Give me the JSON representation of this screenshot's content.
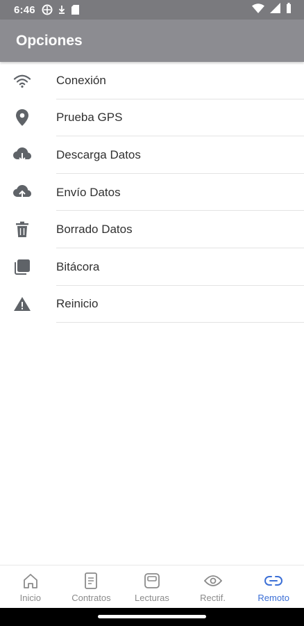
{
  "status_bar": {
    "time": "6:46",
    "icons": [
      "app-icon",
      "download-arrow-icon",
      "sd-card-icon",
      "wifi-icon",
      "signal-icon",
      "battery-icon"
    ]
  },
  "app_bar": {
    "title": "Opciones",
    "color": "#8c8c91"
  },
  "menu": {
    "items": [
      {
        "label": "Conexión",
        "icon": "wifi-icon"
      },
      {
        "label": "Prueba GPS",
        "icon": "location-pin-icon"
      },
      {
        "label": "Descarga Datos",
        "icon": "cloud-download-icon"
      },
      {
        "label": "Envío Datos",
        "icon": "cloud-upload-icon"
      },
      {
        "label": "Borrado Datos",
        "icon": "trash-icon"
      },
      {
        "label": "Bitácora",
        "icon": "copy-icon"
      },
      {
        "label": "Reinicio",
        "icon": "warning-icon"
      }
    ]
  },
  "bottom_nav": {
    "active_color": "#3b6fd6",
    "items": [
      {
        "label": "Inicio",
        "icon": "home-icon",
        "active": false
      },
      {
        "label": "Contratos",
        "icon": "document-icon",
        "active": false
      },
      {
        "label": "Lecturas",
        "icon": "meter-icon",
        "active": false
      },
      {
        "label": "Rectif.",
        "icon": "eye-icon",
        "active": false
      },
      {
        "label": "Remoto",
        "icon": "link-icon",
        "active": true
      }
    ]
  }
}
